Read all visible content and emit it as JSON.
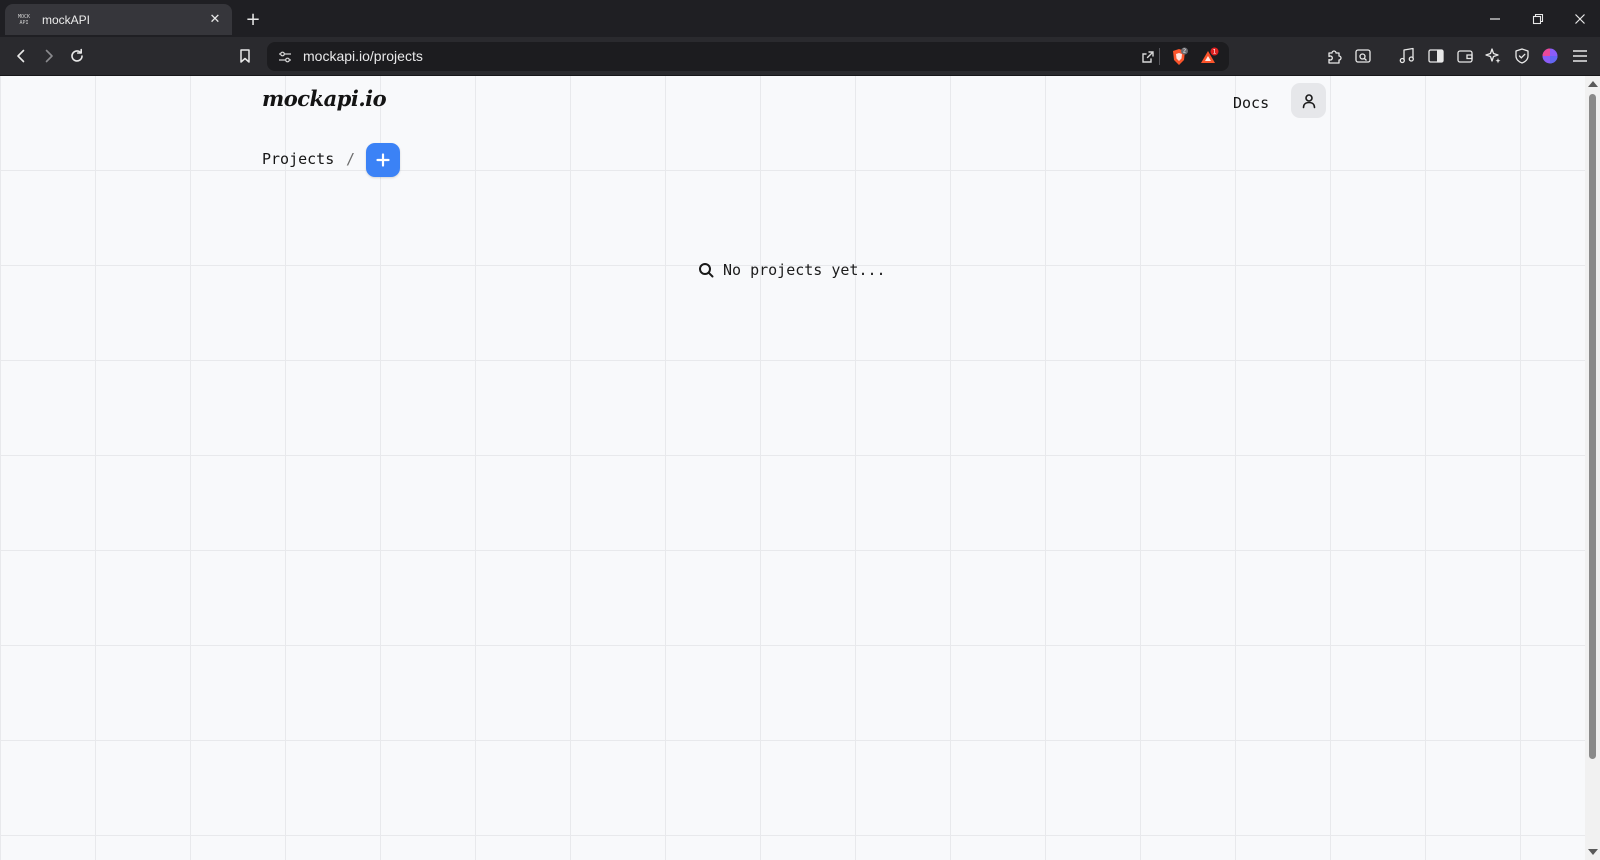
{
  "browser": {
    "tab": {
      "title": "mockAPI",
      "favicon_lines": [
        "MOCK",
        "API"
      ]
    },
    "url": "mockapi.io/projects",
    "icons": {
      "close_tab": "close-icon",
      "new_tab": "plus-icon",
      "back": "back-icon",
      "forward": "forward-icon",
      "reload": "reload-icon",
      "bookmark": "bookmark-icon",
      "site_settings": "tune-icon",
      "share": "share-icon",
      "shields": "brave-shields-icon",
      "rewards": "brave-rewards-icon",
      "extensions": "puzzle-icon",
      "screenshot": "screenshot-icon",
      "media": "music-icon",
      "sidebar": "sidebar-icon",
      "wallet": "wallet-icon",
      "leo": "leo-ai-icon",
      "vpn": "vpn-icon",
      "profile": "profile-icon",
      "menu": "menu-icon"
    },
    "badges": {
      "shields_count": "2",
      "rewards_count": "1"
    }
  },
  "header": {
    "logo": "mockapi.io",
    "docs_link": "Docs"
  },
  "breadcrumb": {
    "projects": "Projects",
    "separator": "/",
    "add_label": "+"
  },
  "main": {
    "empty_state": "No projects yet..."
  },
  "colors": {
    "accent": "#3b82f6",
    "tab_bar": "#1f1f23",
    "toolbar": "#2a2a2e",
    "page_bg": "#f8f9fb",
    "grid_line": "#e8e9ec",
    "brave_orange": "#fb542b"
  }
}
